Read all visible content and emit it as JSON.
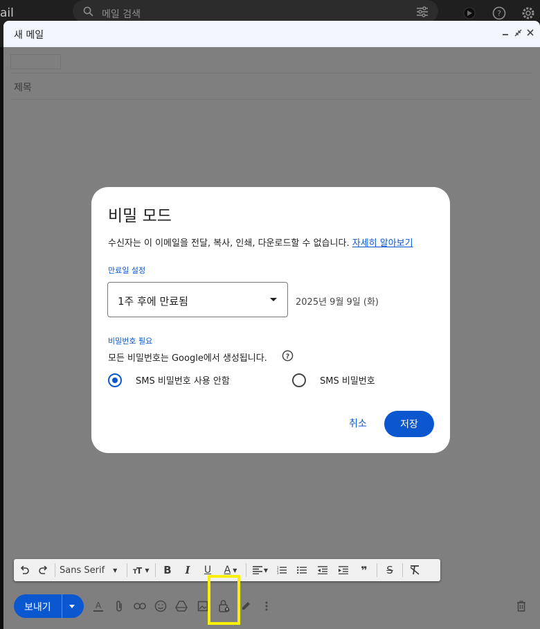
{
  "topbar": {
    "brand_fragment": "ail",
    "search_placeholder": "메일 검색"
  },
  "compose": {
    "title": "새 메일",
    "subject_placeholder": "제목"
  },
  "modal": {
    "title": "비밀 모드",
    "description": "수신자는 이 이메일을 전달, 복사, 인쇄, 다운로드할 수 없습니다.",
    "learn_more": "자세히 알아보기",
    "expiry_label": "만료일 설정",
    "expiry_value": "1주 후에 만료됨",
    "expiry_date": "2025년 9월 9일 (화)",
    "password_label": "비밀번호 필요",
    "password_desc": "모든 비밀번호는 Google에서 생성됩니다.",
    "option_no_sms": "SMS 비밀번호 사용 안함",
    "option_sms": "SMS 비밀번호",
    "selected_option": "option_no_sms",
    "cancel": "취소",
    "save": "저장"
  },
  "toolbar": {
    "font_name": "Sans Serif",
    "send": "보내기"
  },
  "colors": {
    "accent": "#0b57d0",
    "highlight": "#f9f00a",
    "header_bg": "#f2f6fc"
  }
}
